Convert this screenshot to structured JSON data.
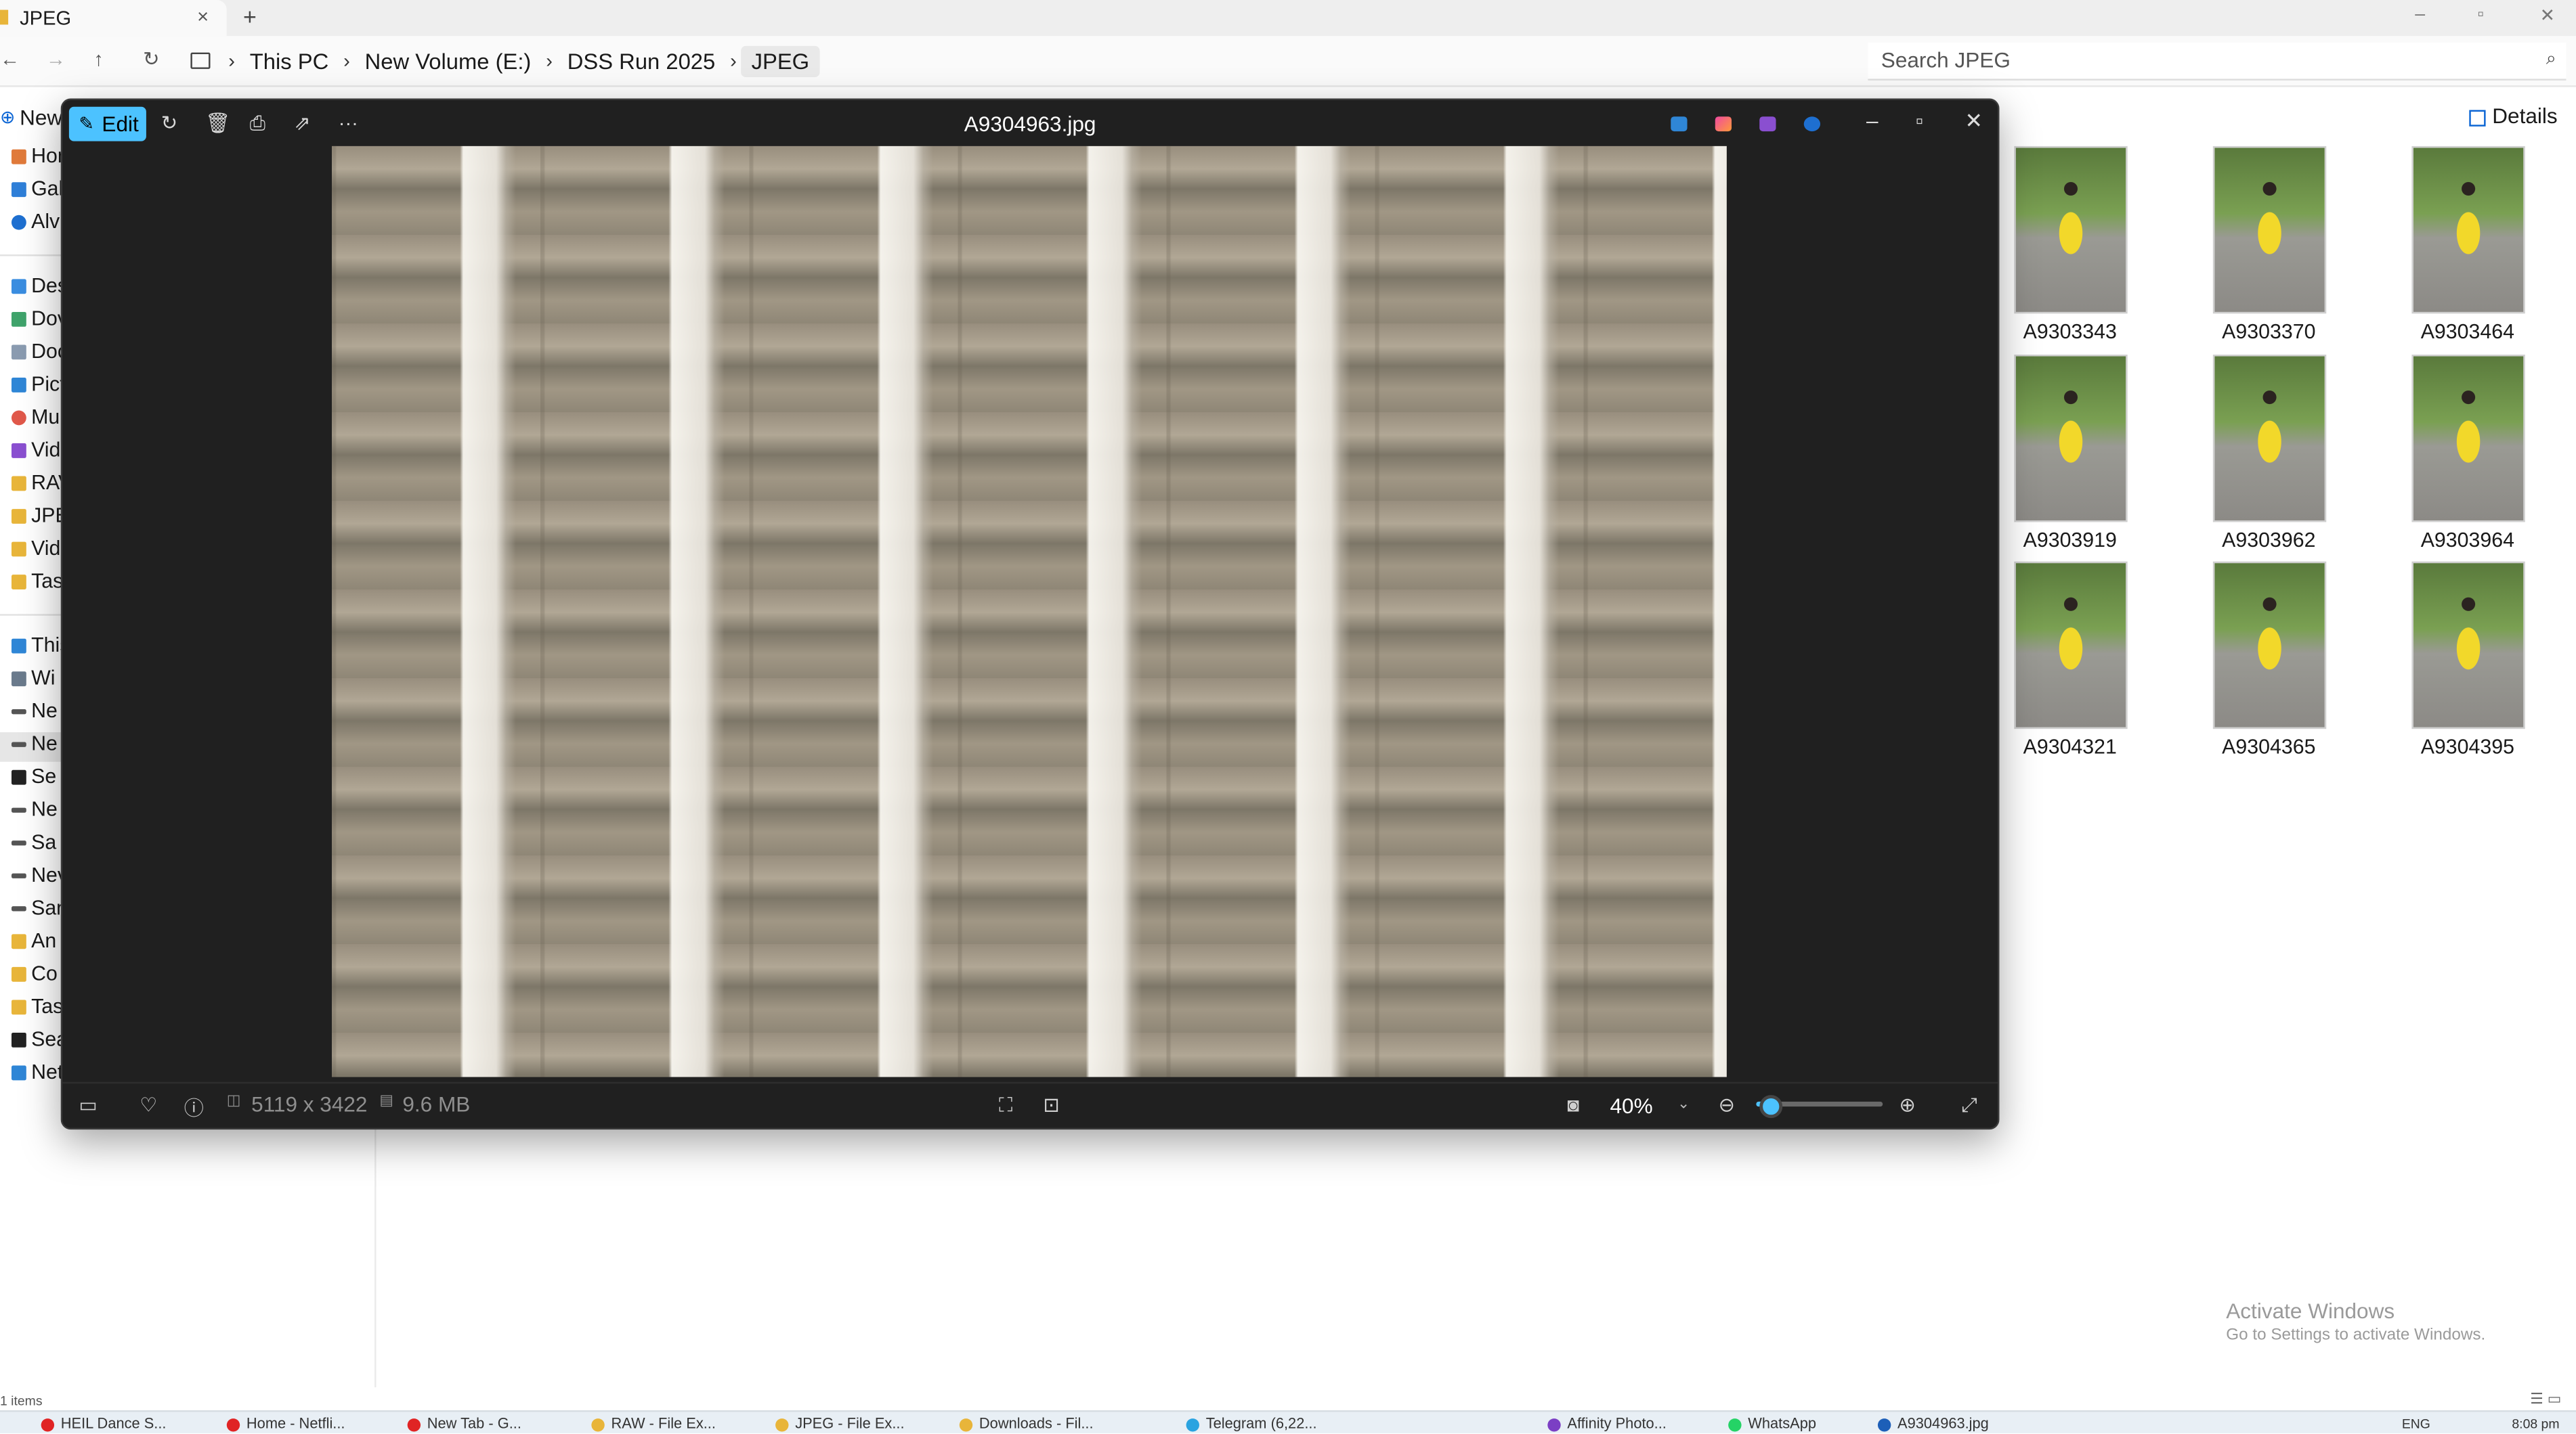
{
  "explorer": {
    "tab_title": "JPEG",
    "tab_close": "×",
    "new_tab": "+",
    "window_controls": {
      "minimize": "–",
      "restore": "▫",
      "close": "✕"
    },
    "nav": {
      "back": "←",
      "forward": "→",
      "up": "↑",
      "refresh": "↻"
    },
    "breadcrumbs": [
      "This PC",
      "New Volume (E:)",
      "DSS Run 2025",
      "JPEG"
    ],
    "search_placeholder": "Search JPEG",
    "command_new": "New",
    "details_label": "Details",
    "nav_pane": [
      "Hor",
      "Gal",
      "Alvi",
      "Des",
      "Dov",
      "Doc",
      "Pict",
      "Mu",
      "Vid",
      "RAV",
      "JPE",
      "Vid",
      "Tas",
      "This",
      "Wi",
      "Ne",
      "Ne",
      "Se",
      "Ne",
      "Sa",
      "Nev",
      "San",
      "An",
      "Co",
      "Tas",
      "Sea",
      "Net"
    ],
    "files": [
      "A9303343",
      "A9303370",
      "A9303464",
      "A9303919",
      "A9303962",
      "A9303964",
      "A9304321",
      "A9304365",
      "A9304395"
    ],
    "status_items": "1 items",
    "activate_title": "Activate Windows",
    "activate_sub": "Go to Settings to activate Windows."
  },
  "viewer": {
    "title": "A9304963.jpg",
    "edit_label": "Edit",
    "dimensions": "5119 x 3422",
    "file_size": "9.6 MB",
    "zoom": "40%",
    "zoom_level": 0.1,
    "toolbar_icons": [
      "rotate-icon",
      "delete-icon",
      "print-icon",
      "share-icon",
      "more-icon"
    ],
    "more_glyph": "···"
  },
  "taskbar": {
    "apps": [
      {
        "label": "HEIL Dance S...",
        "color": "#e02424"
      },
      {
        "label": "Home - Netfli...",
        "color": "#e02424"
      },
      {
        "label": "New Tab - G...",
        "color": "#e02424"
      },
      {
        "label": "RAW - File Ex...",
        "color": "#e8b53a"
      },
      {
        "label": "JPEG - File Ex...",
        "color": "#e8b53a"
      },
      {
        "label": "Downloads - Fil...",
        "color": "#e8b53a"
      },
      {
        "label": "Telegram (6,22...",
        "color": "#2aa3e0"
      },
      {
        "label": "Affinity Photo...",
        "color": "#7b3fc4"
      },
      {
        "label": "WhatsApp",
        "color": "#25d366"
      },
      {
        "label": "A9304963.jpg",
        "color": "#1d5fb8"
      }
    ],
    "lang": "ENG",
    "time": "8:08 pm"
  }
}
